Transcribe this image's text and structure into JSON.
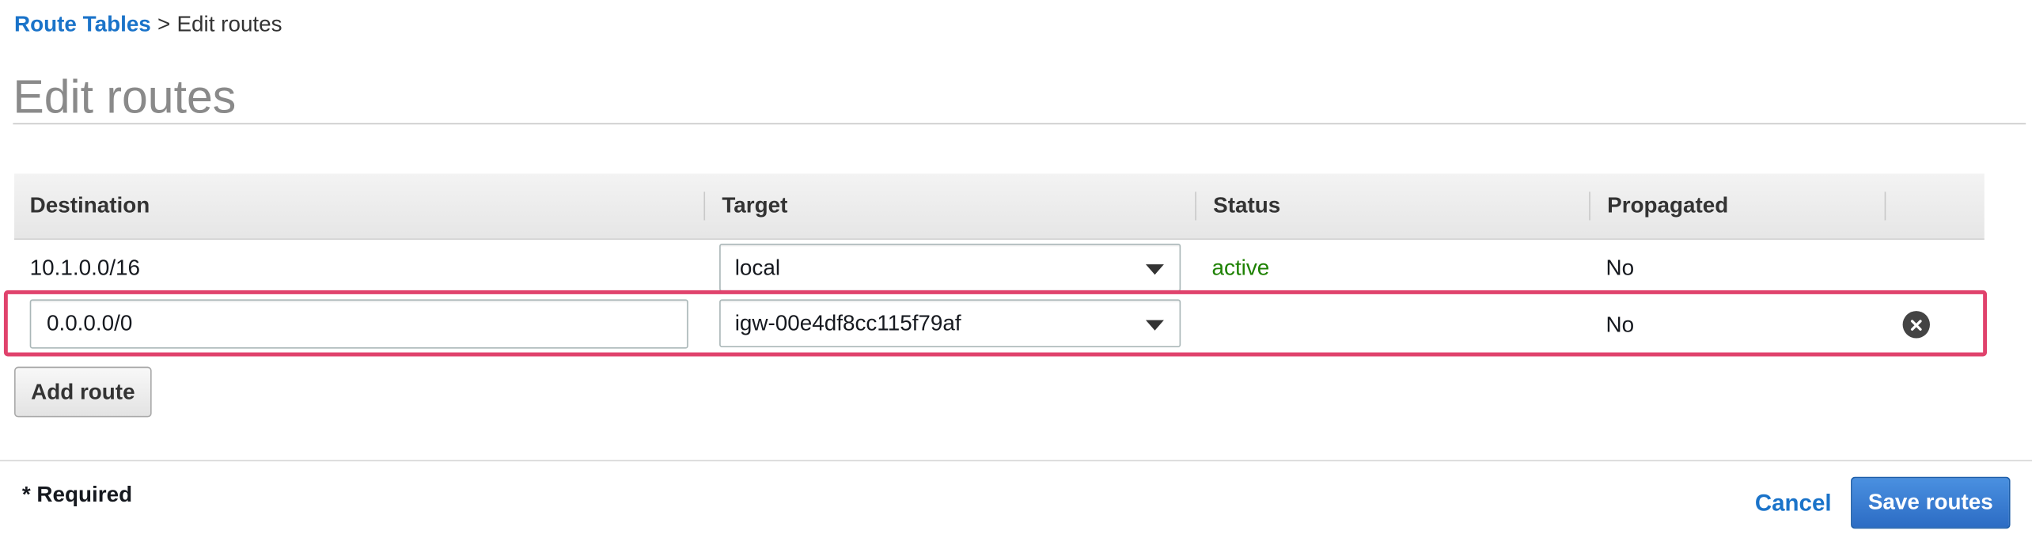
{
  "breadcrumb": {
    "parent": "Route Tables",
    "separator": ">",
    "current": "Edit routes"
  },
  "page": {
    "title": "Edit routes"
  },
  "table": {
    "columns": [
      "Destination",
      "Target",
      "Status",
      "Propagated"
    ],
    "rows": [
      {
        "destination": "10.1.0.0/16",
        "target": "local",
        "status": "active",
        "propagated": "No"
      },
      {
        "destination": "0.0.0.0/0",
        "target": "igw-00e4df8cc115f79af",
        "status": "",
        "propagated": "No"
      }
    ]
  },
  "actions": {
    "add_route": "Add route",
    "required_note": "* Required",
    "cancel": "Cancel",
    "save": "Save routes"
  },
  "icons": {
    "dropdown": "caret-down-icon",
    "remove": "remove-circle-x-icon"
  },
  "colors": {
    "link": "#1a73c9",
    "status_active": "#1d8102",
    "highlight": "#e0426c",
    "primary_button": "#2c6cc4"
  }
}
